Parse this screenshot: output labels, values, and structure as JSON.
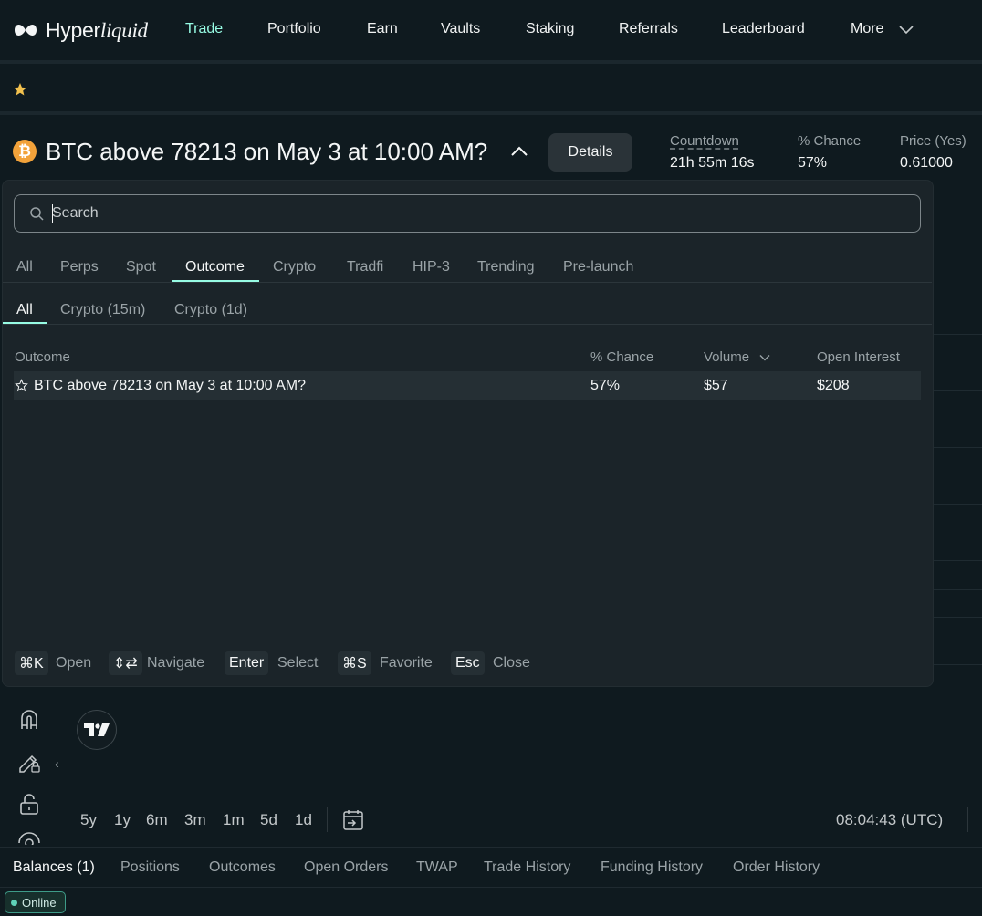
{
  "nav": {
    "logo_text_a": "Hyper",
    "logo_text_b": "liquid",
    "items": [
      {
        "label": "Trade",
        "active": true
      },
      {
        "label": "Portfolio"
      },
      {
        "label": "Earn"
      },
      {
        "label": "Vaults"
      },
      {
        "label": "Staking"
      },
      {
        "label": "Referrals"
      },
      {
        "label": "Leaderboard"
      },
      {
        "label": "More"
      }
    ]
  },
  "market": {
    "icon_glyph": "₿",
    "title": "BTC above 78213 on May 3 at 10:00 AM?",
    "details_label": "Details",
    "stats": [
      {
        "label": "Countdown",
        "value": "21h 55m 16s"
      },
      {
        "label": "% Chance",
        "value": "57%"
      },
      {
        "label": "Price (Yes)",
        "value": "0.61000"
      }
    ]
  },
  "search": {
    "placeholder": "Search",
    "categories": [
      "All",
      "Perps",
      "Spot",
      "Outcome",
      "Crypto",
      "Tradfi",
      "HIP-3",
      "Trending",
      "Pre-launch"
    ],
    "active_category": "Outcome",
    "subcategories": [
      "All",
      "Crypto (15m)",
      "Crypto (1d)"
    ],
    "active_subcategory": "All",
    "columns": [
      "Outcome",
      "% Chance",
      "Volume",
      "Open Interest"
    ],
    "rows": [
      {
        "outcome": "BTC above 78213 on May 3 at 10:00 AM?",
        "chance": "57%",
        "volume": "$57",
        "open_interest": "$208"
      }
    ],
    "shortcuts": [
      {
        "key": "⌘K",
        "label": "Open"
      },
      {
        "key": "⇕⇄",
        "label": "Navigate"
      },
      {
        "key": "Enter",
        "label": "Select"
      },
      {
        "key": "⌘S",
        "label": "Favorite"
      },
      {
        "key": "Esc",
        "label": "Close"
      }
    ]
  },
  "chart": {
    "ranges": [
      "5y",
      "1y",
      "6m",
      "3m",
      "1m",
      "5d",
      "1d"
    ],
    "clock": "08:04:43 (UTC)",
    "collapse_glyph": "‹"
  },
  "bottom_tabs": [
    "Balances (1)",
    "Positions",
    "Outcomes",
    "Open Orders",
    "TWAP",
    "Trade History",
    "Funding History",
    "Order History"
  ],
  "status": {
    "online_label": "Online"
  },
  "colors": {
    "accent": "#97fce4",
    "bitcoin": "#f2a23a",
    "favorite_star": "#f2c14e"
  }
}
